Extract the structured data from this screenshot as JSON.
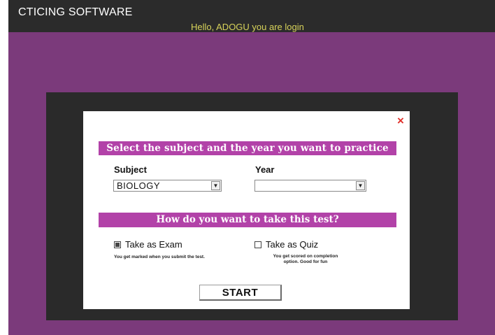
{
  "app": {
    "title": "CTICING SOFTWARE",
    "greeting": "Hello, ADOGU you are login"
  },
  "dialog": {
    "close_label": "×",
    "banner_select": "Select the subject and the year you want to practice",
    "subject_label": "Subject",
    "subject_value": "BIOLOGY",
    "year_label": "Year",
    "year_value": "",
    "banner_mode": "How do you want to take this test?",
    "exam_option": {
      "label": "Take as Exam",
      "checked": true,
      "note": "You get marked when you submit the test."
    },
    "quiz_option": {
      "label": "Take as Quiz",
      "checked": false,
      "note": "You get scored on completion option. Good for fun"
    },
    "start_label": "START"
  },
  "colors": {
    "background_purple": "#7b3a7b",
    "banner_magenta": "#b242a8",
    "topbar_dark": "#2b2b2b",
    "greeting_yellow": "#d7d25a",
    "close_red": "#e0302a"
  },
  "icons": {
    "close": "close-icon",
    "dropdown": "chevron-down-icon"
  }
}
